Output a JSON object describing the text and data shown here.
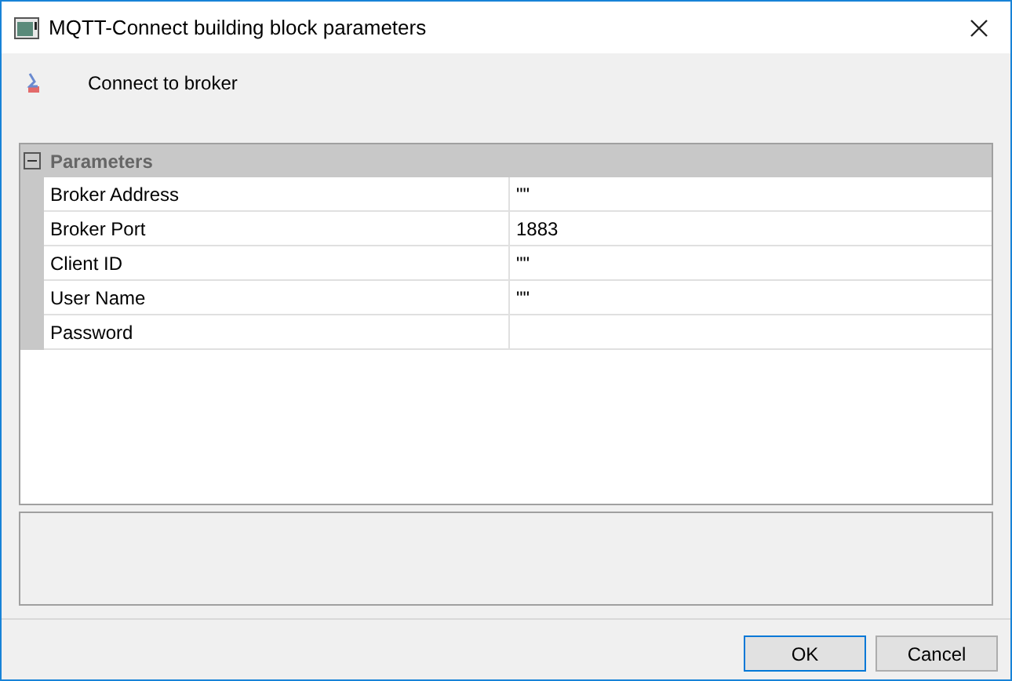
{
  "window": {
    "title": "MQTT-Connect  building block parameters"
  },
  "header": {
    "label": "Connect to broker"
  },
  "grid": {
    "group": {
      "label": "Parameters",
      "expanded": true
    },
    "rows": [
      {
        "name": "Broker Address",
        "value": "\"\""
      },
      {
        "name": "Broker Port",
        "value": "1883"
      },
      {
        "name": "Client ID",
        "value": "\"\""
      },
      {
        "name": "User Name",
        "value": "\"\""
      },
      {
        "name": "Password"
      }
    ]
  },
  "buttons": [
    {
      "label": "OK",
      "default": true
    },
    {
      "label": "Cancel",
      "default": false
    }
  ]
}
